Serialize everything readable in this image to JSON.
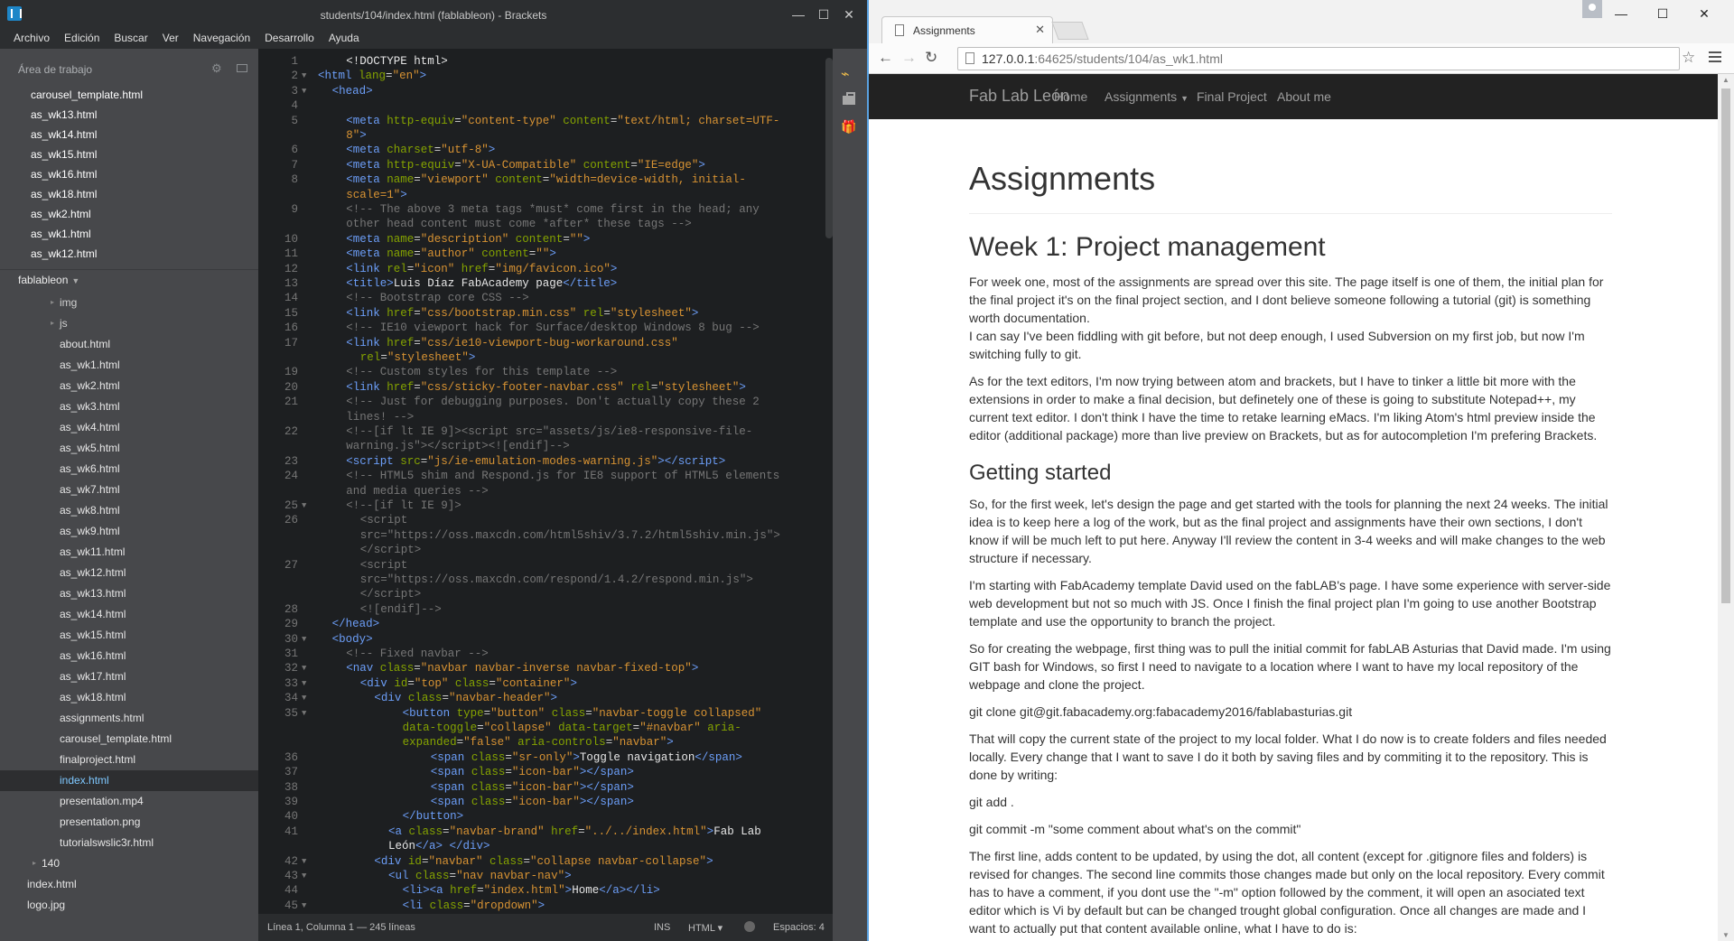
{
  "brackets": {
    "window_title": "students/104/index.html (fablableon) - Brackets",
    "menu": [
      "Archivo",
      "Edición",
      "Buscar",
      "Ver",
      "Navegación",
      "Desarrollo",
      "Ayuda"
    ],
    "working_set_label": "Área de trabajo",
    "working_files": [
      "carousel_template.html",
      "as_wk13.html",
      "as_wk14.html",
      "as_wk15.html",
      "as_wk16.html",
      "as_wk18.html",
      "as_wk2.html",
      "as_wk1.html",
      "as_wk12.html"
    ],
    "project_name": "fablableon",
    "tree": {
      "folders": [
        "img",
        "js"
      ],
      "files": [
        "about.html",
        "as_wk1.html",
        "as_wk2.html",
        "as_wk3.html",
        "as_wk4.html",
        "as_wk5.html",
        "as_wk6.html",
        "as_wk7.html",
        "as_wk8.html",
        "as_wk9.html",
        "as_wk11.html",
        "as_wk12.html",
        "as_wk13.html",
        "as_wk14.html",
        "as_wk15.html",
        "as_wk16.html",
        "as_wk17.html",
        "as_wk18.html",
        "assignments.html",
        "carousel_template.html",
        "finalproject.html",
        "index.html",
        "presentation.mp4",
        "presentation.png",
        "tutorialswslic3r.html"
      ],
      "selected_file": "index.html",
      "collapsed_folder": "140",
      "root_files": [
        "index.html",
        "logo.jpg"
      ]
    },
    "status": {
      "position": "Línea 1, Columna 1 — 245 líneas",
      "mode": "INS",
      "language": "HTML",
      "indent": "Espacios: 4"
    },
    "code_lines": [
      {
        "n": "1",
        "fold": "",
        "html": "<span class='txt'>&lt;!DOCTYPE html&gt;</span>",
        "indent": 2
      },
      {
        "n": "2",
        "fold": "▼",
        "html": "<span class='tag'>&lt;html</span> <span class='attr'>lang</span>=<span class='val'>\"en\"</span><span class='tag'>&gt;</span>",
        "indent": 0
      },
      {
        "n": "3",
        "fold": "▼",
        "html": "<span class='tag'>&lt;head&gt;</span>",
        "indent": 1
      },
      {
        "n": "4",
        "fold": "",
        "html": "",
        "indent": 0
      },
      {
        "n": "5",
        "fold": "",
        "html": "<span class='tag'>&lt;meta</span> <span class='attr'>http-equiv</span>=<span class='val'>\"content-type\"</span> <span class='attr'>content</span>=<span class='val'>\"text/html; charset=UTF-</span>",
        "indent": 2
      },
      {
        "n": "",
        "fold": "",
        "html": "<span class='val'>8\"</span><span class='tag'>&gt;</span>",
        "indent": 2
      },
      {
        "n": "6",
        "fold": "",
        "html": "<span class='tag'>&lt;meta</span> <span class='attr'>charset</span>=<span class='val'>\"utf-8\"</span><span class='tag'>&gt;</span>",
        "indent": 2
      },
      {
        "n": "7",
        "fold": "",
        "html": "<span class='tag'>&lt;meta</span> <span class='attr'>http-equiv</span>=<span class='val'>\"X-UA-Compatible\"</span> <span class='attr'>content</span>=<span class='val'>\"IE=edge\"</span><span class='tag'>&gt;</span>",
        "indent": 2
      },
      {
        "n": "8",
        "fold": "",
        "html": "<span class='tag'>&lt;meta</span> <span class='attr'>name</span>=<span class='val'>\"viewport\"</span> <span class='attr'>content</span>=<span class='val'>\"width=device-width, initial-</span>",
        "indent": 2
      },
      {
        "n": "",
        "fold": "",
        "html": "<span class='val'>scale=1\"</span><span class='tag'>&gt;</span>",
        "indent": 2
      },
      {
        "n": "9",
        "fold": "",
        "html": "<span class='cmt'>&lt;!-- The above 3 meta tags *must* come first in the head; any</span>",
        "indent": 2
      },
      {
        "n": "",
        "fold": "",
        "html": "<span class='cmt'>other head content must come *after* these tags --&gt;</span>",
        "indent": 2
      },
      {
        "n": "10",
        "fold": "",
        "html": "<span class='tag'>&lt;meta</span> <span class='attr'>name</span>=<span class='val'>\"description\"</span> <span class='attr'>content</span>=<span class='val'>\"\"</span><span class='tag'>&gt;</span>",
        "indent": 2
      },
      {
        "n": "11",
        "fold": "",
        "html": "<span class='tag'>&lt;meta</span> <span class='attr'>name</span>=<span class='val'>\"author\"</span> <span class='attr'>content</span>=<span class='val'>\"\"</span><span class='tag'>&gt;</span>",
        "indent": 2
      },
      {
        "n": "12",
        "fold": "",
        "html": "<span class='tag'>&lt;link</span> <span class='attr'>rel</span>=<span class='val'>\"icon\"</span> <span class='attr'>href</span>=<span class='val'>\"img/favicon.ico\"</span><span class='tag'>&gt;</span>",
        "indent": 2
      },
      {
        "n": "13",
        "fold": "",
        "html": "<span class='tag'>&lt;title&gt;</span><span class='txt'>Luis Díaz FabAcademy page</span><span class='tag'>&lt;/title&gt;</span>",
        "indent": 2
      },
      {
        "n": "14",
        "fold": "",
        "html": "<span class='cmt'>&lt;!-- Bootstrap core CSS --&gt;</span>",
        "indent": 2
      },
      {
        "n": "15",
        "fold": "",
        "html": "<span class='tag'>&lt;link</span> <span class='attr'>href</span>=<span class='val'>\"css/bootstrap.min.css\"</span> <span class='attr'>rel</span>=<span class='val'>\"stylesheet\"</span><span class='tag'>&gt;</span>",
        "indent": 2
      },
      {
        "n": "16",
        "fold": "",
        "html": "<span class='cmt'>&lt;!-- IE10 viewport hack for Surface/desktop Windows 8 bug --&gt;</span>",
        "indent": 2
      },
      {
        "n": "17",
        "fold": "",
        "html": "<span class='tag'>&lt;link</span> <span class='attr'>href</span>=<span class='val'>\"css/ie10-viewport-bug-workaround.css\"</span>",
        "indent": 2
      },
      {
        "n": "",
        "fold": "",
        "html": "<span class='attr'>rel</span>=<span class='val'>\"stylesheet\"</span><span class='tag'>&gt;</span>",
        "indent": 3
      },
      {
        "n": "19",
        "fold": "",
        "html": "<span class='cmt'>&lt;!-- Custom styles for this template --&gt;</span>",
        "indent": 2
      },
      {
        "n": "20",
        "fold": "",
        "html": "<span class='tag'>&lt;link</span> <span class='attr'>href</span>=<span class='val'>\"css/sticky-footer-navbar.css\"</span> <span class='attr'>rel</span>=<span class='val'>\"stylesheet\"</span><span class='tag'>&gt;</span>",
        "indent": 2
      },
      {
        "n": "21",
        "fold": "",
        "html": "<span class='cmt'>&lt;!-- Just for debugging purposes. Don't actually copy these 2</span>",
        "indent": 2
      },
      {
        "n": "",
        "fold": "",
        "html": "<span class='cmt'>lines! --&gt;</span>",
        "indent": 2
      },
      {
        "n": "22",
        "fold": "",
        "html": "<span class='cmt'>&lt;!--[if lt IE 9]&gt;&lt;script src=\"assets/js/ie8-responsive-file-</span>",
        "indent": 2
      },
      {
        "n": "",
        "fold": "",
        "html": "<span class='cmt'>warning.js\"&gt;&lt;/script&gt;&lt;![endif]--&gt;</span>",
        "indent": 2
      },
      {
        "n": "23",
        "fold": "",
        "html": "<span class='tag'>&lt;script</span> <span class='attr'>src</span>=<span class='val'>\"js/ie-emulation-modes-warning.js\"</span><span class='tag'>&gt;&lt;/script&gt;</span>",
        "indent": 2
      },
      {
        "n": "24",
        "fold": "",
        "html": "<span class='cmt'>&lt;!-- HTML5 shim and Respond.js for IE8 support of HTML5 elements</span>",
        "indent": 2
      },
      {
        "n": "",
        "fold": "",
        "html": "<span class='cmt'>and media queries --&gt;</span>",
        "indent": 2
      },
      {
        "n": "25",
        "fold": "▼",
        "html": "<span class='cmt'>&lt;!--[if lt IE 9]&gt;</span>",
        "indent": 2
      },
      {
        "n": "26",
        "fold": "",
        "html": "<span class='cmt'>&lt;script</span>",
        "indent": 3
      },
      {
        "n": "",
        "fold": "",
        "html": "<span class='cmt'>src=\"https://oss.maxcdn.com/html5shiv/3.7.2/html5shiv.min.js\"&gt;</span>",
        "indent": 3
      },
      {
        "n": "",
        "fold": "",
        "html": "<span class='cmt'>&lt;/script&gt;</span>",
        "indent": 3
      },
      {
        "n": "27",
        "fold": "",
        "html": "<span class='cmt'>&lt;script</span>",
        "indent": 3
      },
      {
        "n": "",
        "fold": "",
        "html": "<span class='cmt'>src=\"https://oss.maxcdn.com/respond/1.4.2/respond.min.js\"&gt;</span>",
        "indent": 3
      },
      {
        "n": "",
        "fold": "",
        "html": "<span class='cmt'>&lt;/script&gt;</span>",
        "indent": 3
      },
      {
        "n": "28",
        "fold": "",
        "html": "<span class='cmt'>&lt;![endif]--&gt;</span>",
        "indent": 3
      },
      {
        "n": "29",
        "fold": "",
        "html": "<span class='tag'>&lt;/head&gt;</span>",
        "indent": 1
      },
      {
        "n": "30",
        "fold": "▼",
        "html": "<span class='tag'>&lt;body&gt;</span>",
        "indent": 1
      },
      {
        "n": "31",
        "fold": "",
        "html": "<span class='cmt'>&lt;!-- Fixed navbar --&gt;</span>",
        "indent": 2
      },
      {
        "n": "32",
        "fold": "▼",
        "html": "<span class='tag'>&lt;nav</span> <span class='attr'>class</span>=<span class='val'>\"navbar navbar-inverse navbar-fixed-top\"</span><span class='tag'>&gt;</span>",
        "indent": 2
      },
      {
        "n": "33",
        "fold": "▼",
        "html": "<span class='tag'>&lt;div</span> <span class='attr'>id</span>=<span class='val'>\"top\"</span> <span class='attr'>class</span>=<span class='val'>\"container\"</span><span class='tag'>&gt;</span>",
        "indent": 3
      },
      {
        "n": "34",
        "fold": "▼",
        "html": "<span class='tag'>&lt;div</span> <span class='attr'>class</span>=<span class='val'>\"navbar-header\"</span><span class='tag'>&gt;</span>",
        "indent": 4
      },
      {
        "n": "35",
        "fold": "▼",
        "html": "<span class='tag'>&lt;button</span> <span class='attr'>type</span>=<span class='val'>\"button\"</span> <span class='attr'>class</span>=<span class='val'>\"navbar-toggle collapsed\"</span>",
        "indent": 6
      },
      {
        "n": "",
        "fold": "",
        "html": "<span class='attr'>data-toggle</span>=<span class='val'>\"collapse\"</span> <span class='attr'>data-target</span>=<span class='val'>\"#navbar\"</span> <span class='attr'>aria-</span>",
        "indent": 6
      },
      {
        "n": "",
        "fold": "",
        "html": "<span class='attr'>expanded</span>=<span class='val'>\"false\"</span> <span class='attr'>aria-controls</span>=<span class='val'>\"navbar\"</span><span class='tag'>&gt;</span>",
        "indent": 6
      },
      {
        "n": "36",
        "fold": "",
        "html": "<span class='tag'>&lt;span</span> <span class='attr'>class</span>=<span class='val'>\"sr-only\"</span><span class='tag'>&gt;</span><span class='txt'>Toggle navigation</span><span class='tag'>&lt;/span&gt;</span>",
        "indent": 8
      },
      {
        "n": "37",
        "fold": "",
        "html": "<span class='tag'>&lt;span</span> <span class='attr'>class</span>=<span class='val'>\"icon-bar\"</span><span class='tag'>&gt;&lt;/span&gt;</span>",
        "indent": 8
      },
      {
        "n": "38",
        "fold": "",
        "html": "<span class='tag'>&lt;span</span> <span class='attr'>class</span>=<span class='val'>\"icon-bar\"</span><span class='tag'>&gt;&lt;/span&gt;</span>",
        "indent": 8
      },
      {
        "n": "39",
        "fold": "",
        "html": "<span class='tag'>&lt;span</span> <span class='attr'>class</span>=<span class='val'>\"icon-bar\"</span><span class='tag'>&gt;&lt;/span&gt;</span>",
        "indent": 8
      },
      {
        "n": "40",
        "fold": "",
        "html": "<span class='tag'>&lt;/button&gt;</span>",
        "indent": 6
      },
      {
        "n": "41",
        "fold": "",
        "html": "<span class='tag'>&lt;a</span> <span class='attr'>class</span>=<span class='val'>\"navbar-brand\"</span> <span class='attr'>href</span>=<span class='val'>\"../../index.html\"</span><span class='tag'>&gt;</span><span class='txt'>Fab Lab</span>",
        "indent": 5
      },
      {
        "n": "",
        "fold": "",
        "html": "<span class='txt'>León</span><span class='tag'>&lt;/a&gt;</span> <span class='tag'>&lt;/div&gt;</span>",
        "indent": 5
      },
      {
        "n": "42",
        "fold": "▼",
        "html": "<span class='tag'>&lt;div</span> <span class='attr'>id</span>=<span class='val'>\"navbar\"</span> <span class='attr'>class</span>=<span class='val'>\"collapse navbar-collapse\"</span><span class='tag'>&gt;</span>",
        "indent": 4
      },
      {
        "n": "43",
        "fold": "▼",
        "html": "<span class='tag'>&lt;ul</span> <span class='attr'>class</span>=<span class='val'>\"nav navbar-nav\"</span><span class='tag'>&gt;</span>",
        "indent": 5
      },
      {
        "n": "44",
        "fold": "",
        "html": "<span class='tag'>&lt;li&gt;&lt;a</span> <span class='attr'>href</span>=<span class='val'>\"index.html\"</span><span class='tag'>&gt;</span><span class='txt'>Home</span><span class='tag'>&lt;/a&gt;&lt;/li&gt;</span>",
        "indent": 6
      },
      {
        "n": "45",
        "fold": "▼",
        "html": "<span class='tag'>&lt;li</span> <span class='attr'>class</span>=<span class='val'>\"dropdown\"</span><span class='tag'>&gt;</span>",
        "indent": 6
      }
    ]
  },
  "chrome": {
    "tab_title": "Assignments",
    "url_host": "127.0.0.1",
    "url_path": ":64625/students/104/as_wk1.html",
    "page": {
      "brand": "Fab Lab León",
      "nav": [
        "Home",
        "Assignments",
        "Final Project",
        "About me"
      ],
      "h1": "Assignments",
      "h2": "Week 1: Project management",
      "p1": "For week one, most of the assignments are spread over this site. The page itself is one of them, the initial plan for the final project it's on the final project section, and I dont believe someone following a tutorial (git) is something worth documentation.",
      "p1b": "I can say I've been fiddling with git before, but not deep enough, I used Subversion on my first job, but now I'm switching fully to git.",
      "p2": "As for the text editors, I'm now trying between atom and brackets, but I have to tinker a little bit more with the extensions in order to make a final decision, but definetely one of these is going to substitute Notepad++, my current text editor. I don't think I have the time to retake learning eMacs. I'm liking Atom's html preview inside the editor (additional package) more than live preview on Brackets, but as for autocompletion I'm prefering Brackets.",
      "h3": "Getting started",
      "p3": "So, for the first week, let's design the page and get started with the tools for planning the next 24 weeks. The initial idea is to keep here a log of the work, but as the final project and assignments have their own sections, I don't know if will be much left to put here. Anyway I'll review the content in 3-4 weeks and will make changes to the web structure if necessary.",
      "p4": "I'm starting with FabAcademy template David used on the fabLAB's page. I have some experience with server-side web development but not so much with JS. Once I finish the final project plan I'm going to use another Bootstrap template and use the opportunity to branch the project.",
      "p5": "So for creating the webpage, first thing was to pull the initial commit for fabLAB Asturias that David made. I'm using GIT bash for Windows, so first I need to navigate to a location where I want to have my local repository of the webpage and clone the project.",
      "p6": "git clone git@git.fabacademy.org:fabacademy2016/fablabasturias.git",
      "p7": "That will copy the current state of the project to my local folder. What I do now is to create folders and files needed locally. Every change that I want to save I do it both by saving files and by commiting it to the repository. This is done by writing:",
      "p8": "git add .",
      "p9": "git commit -m \"some comment about what's on the commit\"",
      "p10": "The first line, adds content to be updated, by using the dot, all content (except for .gitignore files and folders) is revised for changes. The second line commits those changes made but only on the local repository. Every commit has to have a comment, if you dont use the \"-m\" option followed by the comment, it will open an asociated text editor which is Vi by default but can be changed trought global configuration. Once all changes are made and I want to actually put that content available online, what I have to do is:"
    }
  }
}
